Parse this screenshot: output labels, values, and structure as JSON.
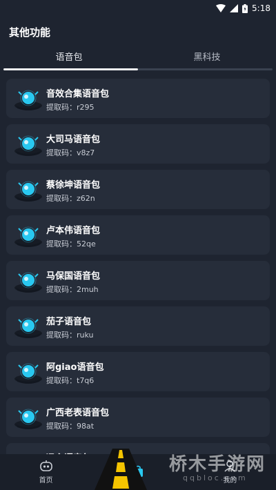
{
  "status_bar": {
    "time": "5:18"
  },
  "header": {
    "title": "其他功能"
  },
  "tabs": [
    {
      "label": "语音包",
      "active": true
    },
    {
      "label": "黑科技",
      "active": false
    }
  ],
  "code_label": "提取码：",
  "voice_packs": [
    {
      "title": "音效合集语音包",
      "code": "r295"
    },
    {
      "title": "大司马语音包",
      "code": "v8z7"
    },
    {
      "title": "蔡徐坤语音包",
      "code": "z62n"
    },
    {
      "title": "卢本伟语音包",
      "code": "52qe"
    },
    {
      "title": "马保国语音包",
      "code": "2muh"
    },
    {
      "title": "茄子语音包",
      "code": "ruku"
    },
    {
      "title": "阿giao语音包",
      "code": "t7q6"
    },
    {
      "title": "广西老表语音包",
      "code": "98at"
    },
    {
      "title": "冯主语音包",
      "code": ""
    }
  ],
  "bottom_nav": [
    {
      "label": "首页",
      "icon": "robot-icon"
    },
    {
      "label": "",
      "icon": "bag-icon"
    },
    {
      "label": "我的",
      "icon": "user-icon"
    }
  ],
  "watermark": {
    "text": "桥木手游网",
    "url_text": "qqbloc.com"
  },
  "colors": {
    "background": "#1e2430",
    "card": "#262d3a",
    "accent": "#29c8f0",
    "nav_background": "#1a1f29"
  }
}
